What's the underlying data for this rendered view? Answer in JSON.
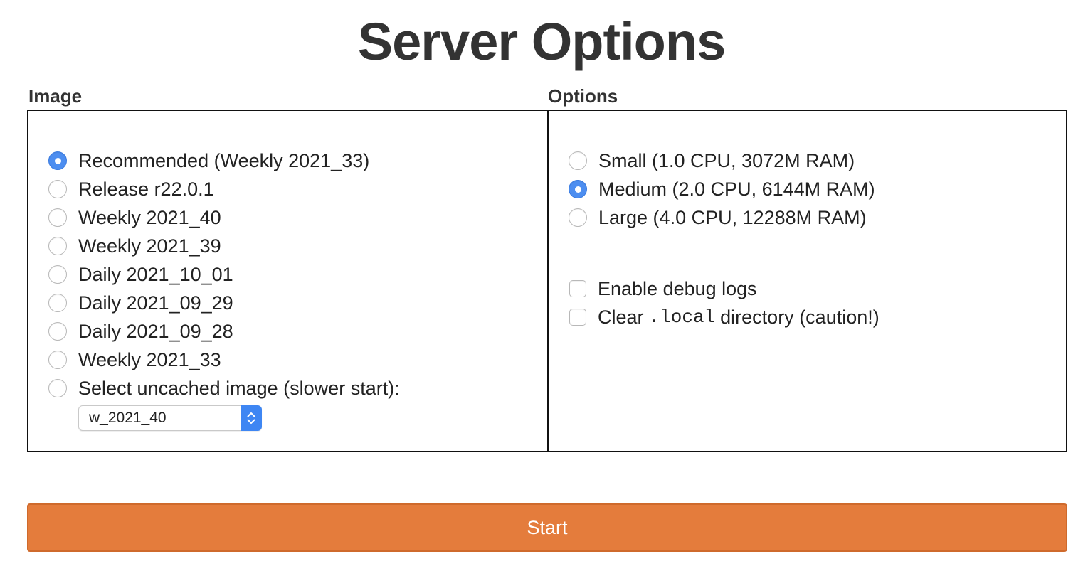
{
  "page": {
    "title": "Server Options"
  },
  "image_panel": {
    "heading": "Image",
    "options": [
      {
        "label": "Recommended (Weekly 2021_33)",
        "selected": true
      },
      {
        "label": "Release r22.0.1",
        "selected": false
      },
      {
        "label": "Weekly 2021_40",
        "selected": false
      },
      {
        "label": "Weekly 2021_39",
        "selected": false
      },
      {
        "label": "Daily 2021_10_01",
        "selected": false
      },
      {
        "label": "Daily 2021_09_29",
        "selected": false
      },
      {
        "label": "Daily 2021_09_28",
        "selected": false
      },
      {
        "label": "Weekly 2021_33",
        "selected": false
      },
      {
        "label": "Select uncached image (slower start):",
        "selected": false
      }
    ],
    "uncached_select": {
      "value": "w_2021_40"
    }
  },
  "options_panel": {
    "heading": "Options",
    "sizes": [
      {
        "label": "Small (1.0 CPU, 3072M RAM)",
        "selected": false
      },
      {
        "label": "Medium (2.0 CPU, 6144M RAM)",
        "selected": true
      },
      {
        "label": "Large (4.0 CPU, 12288M RAM)",
        "selected": false
      }
    ],
    "debug_logs": {
      "label": "Enable debug logs",
      "checked": false
    },
    "clear_local": {
      "label_before": "Clear",
      "code": ".local",
      "label_after": "directory (caution!)",
      "checked": false
    }
  },
  "actions": {
    "start_label": "Start"
  },
  "colors": {
    "accent_radio": "#4d8ef0",
    "start_button": "#e47c3c",
    "select_arrows": "#3e86f3"
  },
  "icons": {
    "select_arrows": "chevron-up-down-icon"
  }
}
